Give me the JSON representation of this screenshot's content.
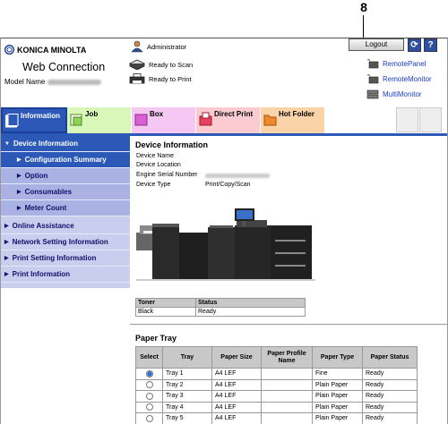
{
  "callout": {
    "number": "8"
  },
  "header": {
    "brand": "KONICA MINOLTA",
    "app_title": "Web Connection",
    "model_label": "Model Name",
    "user": "Administrator",
    "status_scan": "Ready to Scan",
    "status_print": "Ready to Print",
    "logout_label": "Logout",
    "refresh_icon": "refresh-icon",
    "help_icon": "help-icon"
  },
  "remote_links": [
    "RemotePanel",
    "RemoteMonitor",
    "MultiMonitor"
  ],
  "tabs": [
    {
      "label": "Information",
      "icon": "information-icon"
    },
    {
      "label": "Job",
      "icon": "job-icon"
    },
    {
      "label": "Box",
      "icon": "box-icon"
    },
    {
      "label": "Direct Print",
      "icon": "direct-print-icon"
    },
    {
      "label": "Hot Folder",
      "icon": "hot-folder-icon"
    }
  ],
  "sidebar": {
    "items": [
      {
        "label": "Device Information"
      },
      {
        "label": "Configuration Summary"
      },
      {
        "label": "Option"
      },
      {
        "label": "Consumables"
      },
      {
        "label": "Meter Count"
      },
      {
        "label": "Online Assistance"
      },
      {
        "label": "Network Setting Information"
      },
      {
        "label": "Print Setting Information"
      },
      {
        "label": "Print Information"
      }
    ]
  },
  "device_info": {
    "title": "Device Information",
    "fields": [
      {
        "label": "Device Name",
        "value": ""
      },
      {
        "label": "Device Location",
        "value": ""
      },
      {
        "label": "Engine Serial Number",
        "value": ""
      },
      {
        "label": "Device Type",
        "value": "Print/Copy/Scan"
      }
    ]
  },
  "toner": {
    "headers": [
      "Toner",
      "Status"
    ],
    "rows": [
      [
        "Black",
        "Ready"
      ]
    ]
  },
  "paper_tray": {
    "title": "Paper Tray",
    "headers": [
      "Select",
      "Tray",
      "Paper Size",
      "Paper Profile Name",
      "Paper Type",
      "Paper Status"
    ],
    "rows": [
      {
        "selected": true,
        "tray": "Tray 1",
        "size": "A4 LEF",
        "profile": "",
        "type": "Fine",
        "status": "Ready"
      },
      {
        "selected": false,
        "tray": "Tray 2",
        "size": "A4 LEF",
        "profile": "",
        "type": "Plain Paper",
        "status": "Ready"
      },
      {
        "selected": false,
        "tray": "Tray 3",
        "size": "A4 LEF",
        "profile": "",
        "type": "Plain Paper",
        "status": "Ready"
      },
      {
        "selected": false,
        "tray": "Tray 4",
        "size": "A4 LEF",
        "profile": "",
        "type": "Plain Paper",
        "status": "Ready"
      },
      {
        "selected": false,
        "tray": "Tray 5",
        "size": "A4 LEF",
        "profile": "",
        "type": "Plain Paper",
        "status": "Ready"
      }
    ]
  },
  "colors": {
    "primary": "#2c59b8",
    "sidebar_bg": "#c9cdee",
    "link": "#1a3acc"
  }
}
